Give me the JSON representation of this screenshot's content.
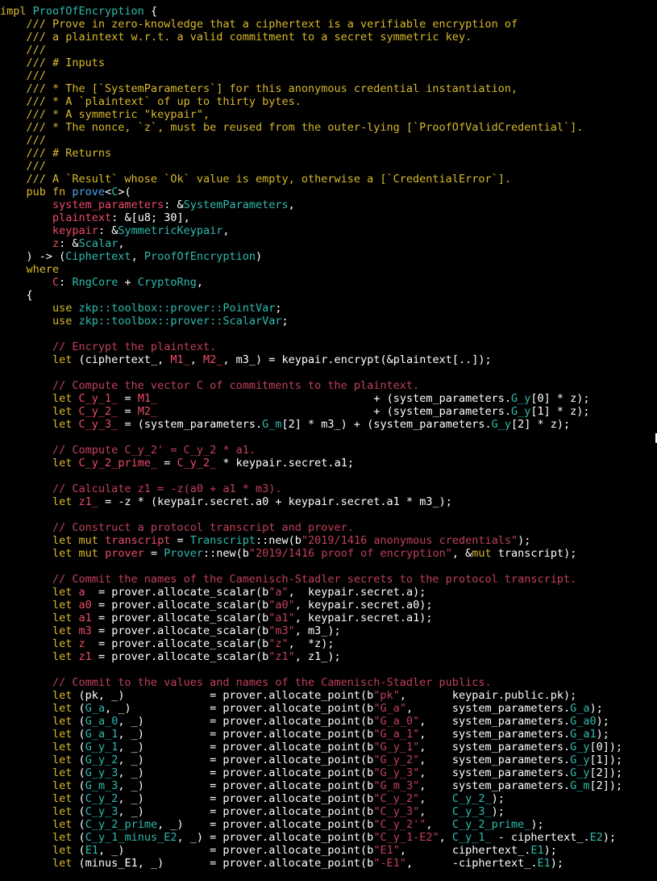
{
  "editor": {
    "lines": [
      [
        [
          "impl ",
          "kw"
        ],
        [
          "ProofOfEncryption",
          "ty"
        ],
        [
          " {",
          "pl"
        ]
      ],
      [
        [
          "    /// Prove in zero-knowledge that a ciphertext is a verifiable encryption of",
          "doc"
        ]
      ],
      [
        [
          "    /// a plaintext w.r.t. a valid commitment to a secret symmetric key.",
          "doc"
        ]
      ],
      [
        [
          "    ///",
          "doc"
        ]
      ],
      [
        [
          "    /// # Inputs",
          "doc"
        ]
      ],
      [
        [
          "    ///",
          "doc"
        ]
      ],
      [
        [
          "    /// * The [`SystemParameters`] for this anonymous credential instantiation,",
          "doc"
        ]
      ],
      [
        [
          "    /// * A `plaintext` of up to thirty bytes.",
          "doc"
        ]
      ],
      [
        [
          "    /// * A symmetric \"keypair\",",
          "doc"
        ]
      ],
      [
        [
          "    /// * The nonce, `z`, must be reused from the outer-lying [`ProofOfValidCredential`].",
          "doc"
        ]
      ],
      [
        [
          "    ///",
          "doc"
        ]
      ],
      [
        [
          "    /// # Returns",
          "doc"
        ]
      ],
      [
        [
          "    ///",
          "doc"
        ]
      ],
      [
        [
          "    /// A `Result` whose `Ok` value is empty, otherwise a [`CredentialError`].",
          "doc"
        ]
      ],
      [
        [
          "    ",
          "pl"
        ],
        [
          "pub fn ",
          "kw"
        ],
        [
          "prove",
          "fn"
        ],
        [
          "<",
          "pl"
        ],
        [
          "C",
          "ty"
        ],
        [
          ">(",
          "pl"
        ]
      ],
      [
        [
          "        ",
          "pl"
        ],
        [
          "system_parameters",
          "var"
        ],
        [
          ": &",
          "pl"
        ],
        [
          "SystemParameters",
          "ty"
        ],
        [
          ",",
          "pl"
        ]
      ],
      [
        [
          "        ",
          "pl"
        ],
        [
          "plaintext",
          "var"
        ],
        [
          ": &[u8; 30],",
          "pl"
        ]
      ],
      [
        [
          "        ",
          "pl"
        ],
        [
          "keypair",
          "var"
        ],
        [
          ": &",
          "pl"
        ],
        [
          "SymmetricKeypair",
          "ty"
        ],
        [
          ",",
          "pl"
        ]
      ],
      [
        [
          "        ",
          "pl"
        ],
        [
          "z",
          "var"
        ],
        [
          ": &",
          "pl"
        ],
        [
          "Scalar",
          "ty"
        ],
        [
          ",",
          "pl"
        ]
      ],
      [
        [
          "    ) -> (",
          "pl"
        ],
        [
          "Ciphertext",
          "ty"
        ],
        [
          ", ",
          "pl"
        ],
        [
          "ProofOfEncryption",
          "ty"
        ],
        [
          ")",
          "pl"
        ]
      ],
      [
        [
          "    ",
          "pl"
        ],
        [
          "where",
          "kw"
        ]
      ],
      [
        [
          "        ",
          "pl"
        ],
        [
          "C",
          "var"
        ],
        [
          ": ",
          "pl"
        ],
        [
          "RngCore",
          "ty"
        ],
        [
          " + ",
          "pl"
        ],
        [
          "CryptoRng",
          "ty"
        ],
        [
          ",",
          "pl"
        ]
      ],
      [
        [
          "    {",
          "pl"
        ]
      ],
      [
        [
          "        ",
          "pl"
        ],
        [
          "use ",
          "kw"
        ],
        [
          "zkp::toolbox::prover::",
          "ty"
        ],
        [
          "PointVar",
          "ty"
        ],
        [
          ";",
          "pl"
        ]
      ],
      [
        [
          "        ",
          "pl"
        ],
        [
          "use ",
          "kw"
        ],
        [
          "zkp::toolbox::prover::",
          "ty"
        ],
        [
          "ScalarVar",
          "ty"
        ],
        [
          ";",
          "pl"
        ]
      ],
      [
        [
          "",
          "pl"
        ]
      ],
      [
        [
          "        // Encrypt the plaintext.",
          "cmt"
        ]
      ],
      [
        [
          "        ",
          "pl"
        ],
        [
          "let ",
          "kw"
        ],
        [
          "(ciphertext_, ",
          "pl"
        ],
        [
          "M1_",
          "var"
        ],
        [
          ", ",
          "pl"
        ],
        [
          "M2_",
          "var"
        ],
        [
          ", m3_) = keypair.encrypt(&plaintext[..]);",
          "pl"
        ]
      ],
      [
        [
          "",
          "pl"
        ]
      ],
      [
        [
          "        // Compute the vector C of commitments to the plaintext.",
          "cmt"
        ]
      ],
      [
        [
          "        ",
          "pl"
        ],
        [
          "let ",
          "kw"
        ],
        [
          "C_y_1_",
          "var"
        ],
        [
          " = ",
          "pl"
        ],
        [
          "M1_",
          "var"
        ],
        [
          "                                 + (system_parameters.",
          "pl"
        ],
        [
          "G_y",
          "ty"
        ],
        [
          "[0] * z);",
          "pl"
        ]
      ],
      [
        [
          "        ",
          "pl"
        ],
        [
          "let ",
          "kw"
        ],
        [
          "C_y_2_",
          "var"
        ],
        [
          " = ",
          "pl"
        ],
        [
          "M2_",
          "var"
        ],
        [
          "                                 + (system_parameters.",
          "pl"
        ],
        [
          "G_y",
          "ty"
        ],
        [
          "[1] * z);",
          "pl"
        ]
      ],
      [
        [
          "        ",
          "pl"
        ],
        [
          "let ",
          "kw"
        ],
        [
          "C_y_3_",
          "var"
        ],
        [
          " = (system_parameters.",
          "pl"
        ],
        [
          "G_m",
          "ty"
        ],
        [
          "[2] * m3_) + (system_parameters.",
          "pl"
        ],
        [
          "G_y",
          "ty"
        ],
        [
          "[2] * z);",
          "pl"
        ]
      ],
      [
        [
          "",
          "pl"
        ]
      ],
      [
        [
          "        // Compute C_y_2' = C_y_2 * a1.",
          "cmt"
        ]
      ],
      [
        [
          "        ",
          "pl"
        ],
        [
          "let ",
          "kw"
        ],
        [
          "C_y_2_prime_",
          "var"
        ],
        [
          " = ",
          "pl"
        ],
        [
          "C_y_2_",
          "var"
        ],
        [
          " * keypair.secret.a1;",
          "pl"
        ]
      ],
      [
        [
          "",
          "pl"
        ]
      ],
      [
        [
          "        // Calculate z1 = -z(a0 + a1 * m3).",
          "cmt"
        ]
      ],
      [
        [
          "        ",
          "pl"
        ],
        [
          "let ",
          "kw"
        ],
        [
          "z1_",
          "var"
        ],
        [
          " = -z * (keypair.secret.a0 + keypair.secret.a1 * m3_);",
          "pl"
        ]
      ],
      [
        [
          "",
          "pl"
        ]
      ],
      [
        [
          "        // Construct a protocol transcript and prover.",
          "cmt"
        ]
      ],
      [
        [
          "        ",
          "pl"
        ],
        [
          "let mut ",
          "kw"
        ],
        [
          "transcript",
          "var"
        ],
        [
          " = ",
          "pl"
        ],
        [
          "Transcript",
          "ty"
        ],
        [
          "::new(b",
          "pl"
        ],
        [
          "\"2019/1416 anonymous credentials\"",
          "str"
        ],
        [
          ");",
          "pl"
        ]
      ],
      [
        [
          "        ",
          "pl"
        ],
        [
          "let mut ",
          "kw"
        ],
        [
          "prover",
          "var"
        ],
        [
          " = ",
          "pl"
        ],
        [
          "Prover",
          "ty"
        ],
        [
          "::new(b",
          "pl"
        ],
        [
          "\"2019/1416 proof of encryption\"",
          "str"
        ],
        [
          ", &",
          "pl"
        ],
        [
          "mut ",
          "kw"
        ],
        [
          "transcript);",
          "pl"
        ]
      ],
      [
        [
          "",
          "pl"
        ]
      ],
      [
        [
          "        // Commit the names of the Camenisch-Stadler secrets to the protocol transcript.",
          "cmt"
        ]
      ],
      [
        [
          "        ",
          "pl"
        ],
        [
          "let ",
          "kw"
        ],
        [
          "a",
          "var"
        ],
        [
          "  = prover.allocate_scalar(b",
          "pl"
        ],
        [
          "\"a\"",
          "str"
        ],
        [
          ",  keypair.secret.a);",
          "pl"
        ]
      ],
      [
        [
          "        ",
          "pl"
        ],
        [
          "let ",
          "kw"
        ],
        [
          "a0",
          "var"
        ],
        [
          " = prover.allocate_scalar(b",
          "pl"
        ],
        [
          "\"a0\"",
          "str"
        ],
        [
          ", keypair.secret.a0);",
          "pl"
        ]
      ],
      [
        [
          "        ",
          "pl"
        ],
        [
          "let ",
          "kw"
        ],
        [
          "a1",
          "var"
        ],
        [
          " = prover.allocate_scalar(b",
          "pl"
        ],
        [
          "\"a1\"",
          "str"
        ],
        [
          ", keypair.secret.a1);",
          "pl"
        ]
      ],
      [
        [
          "        ",
          "pl"
        ],
        [
          "let ",
          "kw"
        ],
        [
          "m3",
          "var"
        ],
        [
          " = prover.allocate_scalar(b",
          "pl"
        ],
        [
          "\"m3\"",
          "str"
        ],
        [
          ", m3_);",
          "pl"
        ]
      ],
      [
        [
          "        ",
          "pl"
        ],
        [
          "let ",
          "kw"
        ],
        [
          "z",
          "var"
        ],
        [
          "  = prover.allocate_scalar(b",
          "pl"
        ],
        [
          "\"z\"",
          "str"
        ],
        [
          ",  *z);",
          "pl"
        ]
      ],
      [
        [
          "        ",
          "pl"
        ],
        [
          "let ",
          "kw"
        ],
        [
          "z1",
          "var"
        ],
        [
          " = prover.allocate_scalar(b",
          "pl"
        ],
        [
          "\"z1\"",
          "str"
        ],
        [
          ", z1_);",
          "pl"
        ]
      ],
      [
        [
          "",
          "pl"
        ]
      ],
      [
        [
          "        // Commit to the values and names of the Camenisch-Stadler publics.",
          "cmt"
        ]
      ],
      [
        [
          "        ",
          "pl"
        ],
        [
          "let ",
          "kw"
        ],
        [
          "(pk, _)             = prover.allocate_point(b",
          "pl"
        ],
        [
          "\"pk\"",
          "str"
        ],
        [
          ",       keypair.public.pk);",
          "pl"
        ]
      ],
      [
        [
          "        ",
          "pl"
        ],
        [
          "let ",
          "kw"
        ],
        [
          "(",
          "pl"
        ],
        [
          "G_a",
          "ty"
        ],
        [
          ", _)            = prover.allocate_point(b",
          "pl"
        ],
        [
          "\"G_a\"",
          "str"
        ],
        [
          ",      system_parameters.",
          "pl"
        ],
        [
          "G_a",
          "ty"
        ],
        [
          ");",
          "pl"
        ]
      ],
      [
        [
          "        ",
          "pl"
        ],
        [
          "let ",
          "kw"
        ],
        [
          "(",
          "pl"
        ],
        [
          "G_a_0",
          "ty"
        ],
        [
          ", _)          = prover.allocate_point(b",
          "pl"
        ],
        [
          "\"G_a_0\"",
          "str"
        ],
        [
          ",    system_parameters.",
          "pl"
        ],
        [
          "G_a0",
          "ty"
        ],
        [
          ");",
          "pl"
        ]
      ],
      [
        [
          "        ",
          "pl"
        ],
        [
          "let ",
          "kw"
        ],
        [
          "(",
          "pl"
        ],
        [
          "G_a_1",
          "ty"
        ],
        [
          ", _)          = prover.allocate_point(b",
          "pl"
        ],
        [
          "\"G_a_1\"",
          "str"
        ],
        [
          ",    system_parameters.",
          "pl"
        ],
        [
          "G_a1",
          "ty"
        ],
        [
          ");",
          "pl"
        ]
      ],
      [
        [
          "        ",
          "pl"
        ],
        [
          "let ",
          "kw"
        ],
        [
          "(",
          "pl"
        ],
        [
          "G_y_1",
          "ty"
        ],
        [
          ", _)          = prover.allocate_point(b",
          "pl"
        ],
        [
          "\"G_y_1\"",
          "str"
        ],
        [
          ",    system_parameters.",
          "pl"
        ],
        [
          "G_y",
          "ty"
        ],
        [
          "[0]);",
          "pl"
        ]
      ],
      [
        [
          "        ",
          "pl"
        ],
        [
          "let ",
          "kw"
        ],
        [
          "(",
          "pl"
        ],
        [
          "G_y_2",
          "ty"
        ],
        [
          ", _)          = prover.allocate_point(b",
          "pl"
        ],
        [
          "\"G_y_2\"",
          "str"
        ],
        [
          ",    system_parameters.",
          "pl"
        ],
        [
          "G_y",
          "ty"
        ],
        [
          "[1]);",
          "pl"
        ]
      ],
      [
        [
          "        ",
          "pl"
        ],
        [
          "let ",
          "kw"
        ],
        [
          "(",
          "pl"
        ],
        [
          "G_y_3",
          "ty"
        ],
        [
          ", _)          = prover.allocate_point(b",
          "pl"
        ],
        [
          "\"G_y_3\"",
          "str"
        ],
        [
          ",    system_parameters.",
          "pl"
        ],
        [
          "G_y",
          "ty"
        ],
        [
          "[2]);",
          "pl"
        ]
      ],
      [
        [
          "        ",
          "pl"
        ],
        [
          "let ",
          "kw"
        ],
        [
          "(",
          "pl"
        ],
        [
          "G_m_3",
          "ty"
        ],
        [
          ", _)          = prover.allocate_point(b",
          "pl"
        ],
        [
          "\"G_m_3\"",
          "str"
        ],
        [
          ",    system_parameters.",
          "pl"
        ],
        [
          "G_m",
          "ty"
        ],
        [
          "[2]);",
          "pl"
        ]
      ],
      [
        [
          "        ",
          "pl"
        ],
        [
          "let ",
          "kw"
        ],
        [
          "(",
          "pl"
        ],
        [
          "C_y_2",
          "ty"
        ],
        [
          ", _)          = prover.allocate_point(b",
          "pl"
        ],
        [
          "\"C_y_2\"",
          "str"
        ],
        [
          ",    ",
          "pl"
        ],
        [
          "C_y_2_",
          "ty"
        ],
        [
          ");",
          "pl"
        ]
      ],
      [
        [
          "        ",
          "pl"
        ],
        [
          "let ",
          "kw"
        ],
        [
          "(",
          "pl"
        ],
        [
          "C_y_3",
          "ty"
        ],
        [
          ", _)          = prover.allocate_point(b",
          "pl"
        ],
        [
          "\"C_y_3\"",
          "str"
        ],
        [
          ",    ",
          "pl"
        ],
        [
          "C_y_3_",
          "ty"
        ],
        [
          ");",
          "pl"
        ]
      ],
      [
        [
          "        ",
          "pl"
        ],
        [
          "let ",
          "kw"
        ],
        [
          "(",
          "pl"
        ],
        [
          "C_y_2_prime",
          "ty"
        ],
        [
          ", _)    = prover.allocate_point(b",
          "pl"
        ],
        [
          "\"C_y_2'\"",
          "str"
        ],
        [
          ",   ",
          "pl"
        ],
        [
          "C_y_2_prime_",
          "ty"
        ],
        [
          ");",
          "pl"
        ]
      ],
      [
        [
          "        ",
          "pl"
        ],
        [
          "let ",
          "kw"
        ],
        [
          "(",
          "pl"
        ],
        [
          "C_y_1_minus_E2",
          "ty"
        ],
        [
          ", _) = prover.allocate_point(b",
          "pl"
        ],
        [
          "\"C_y_1-E2\"",
          "str"
        ],
        [
          ", ",
          "pl"
        ],
        [
          "C_y_1_",
          "ty"
        ],
        [
          " - ciphertext_.",
          "pl"
        ],
        [
          "E2",
          "ty"
        ],
        [
          ");",
          "pl"
        ]
      ],
      [
        [
          "        ",
          "pl"
        ],
        [
          "let ",
          "kw"
        ],
        [
          "(",
          "pl"
        ],
        [
          "E1",
          "ty"
        ],
        [
          ", _)             = prover.allocate_point(b",
          "pl"
        ],
        [
          "\"E1\"",
          "str"
        ],
        [
          ",       ciphertext_.",
          "pl"
        ],
        [
          "E1",
          "ty"
        ],
        [
          ");",
          "pl"
        ]
      ],
      [
        [
          "        ",
          "pl"
        ],
        [
          "let ",
          "kw"
        ],
        [
          "(minus_E1, _)       = prover.allocate_point(b",
          "pl"
        ],
        [
          "\"-E1\"",
          "str"
        ],
        [
          ",      -ciphertext_.",
          "pl"
        ],
        [
          "E1",
          "ty"
        ],
        [
          ");",
          "pl"
        ]
      ]
    ]
  },
  "colors": {
    "background": "#000000",
    "plain": "#ffffff",
    "keyword": "#d8b92c",
    "type": "#2ebbaf",
    "variable": "#ec4b68",
    "doc_comment": "#d8b92c",
    "comment": "#c0405a",
    "string": "#c0405a",
    "function": "#4aa3f0"
  }
}
